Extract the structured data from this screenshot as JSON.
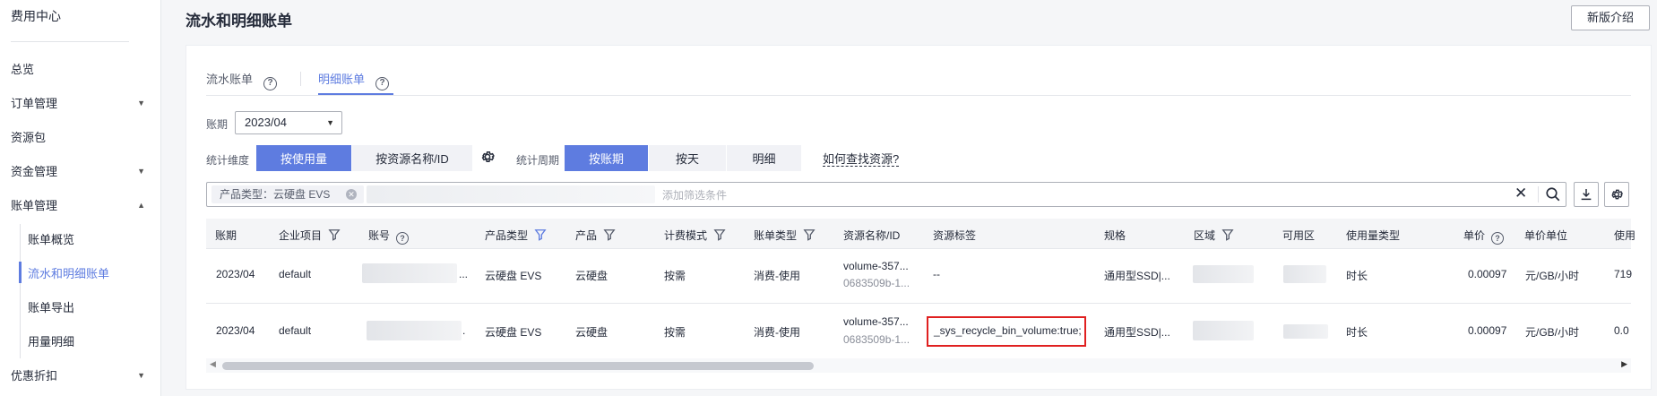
{
  "sidebar": {
    "brand": "费用中心",
    "items": [
      {
        "label": "总览"
      },
      {
        "label": "订单管理"
      },
      {
        "label": "资源包"
      },
      {
        "label": "资金管理"
      },
      {
        "label": "账单管理"
      },
      {
        "label": "优惠折扣"
      }
    ],
    "sub_items": [
      {
        "label": "账单概览"
      },
      {
        "label": "流水和明细账单"
      },
      {
        "label": "账单导出"
      },
      {
        "label": "用量明细"
      }
    ]
  },
  "header": {
    "title": "流水和明细账单",
    "intro_button": "新版介绍"
  },
  "tabs": [
    {
      "label": "流水账单"
    },
    {
      "label": "明细账单"
    }
  ],
  "filters": {
    "period_label": "账期",
    "period_value": "2023/04",
    "dimension_label": "统计维度",
    "dimension_options": [
      "按使用量",
      "按资源名称/ID"
    ],
    "cycle_label": "统计周期",
    "cycle_options": [
      "按账期",
      "按天",
      "明细"
    ],
    "howto_link": "如何查找资源?",
    "chip_label": "产品类型：云硬盘 EVS",
    "add_filter_placeholder": "添加筛选条件"
  },
  "table": {
    "columns": [
      "账期",
      "企业项目",
      "账号",
      "产品类型",
      "产品",
      "计费模式",
      "账单类型",
      "资源名称/ID",
      "资源标签",
      "规格",
      "区域",
      "可用区",
      "使用量类型",
      "单价",
      "单价单位",
      "使用"
    ],
    "rows": [
      {
        "period": "2023/04",
        "project": "default",
        "account_suffix": "...",
        "product_type": "云硬盘 EVS",
        "product": "云硬盘",
        "billing_mode": "按需",
        "bill_type": "消费-使用",
        "resource_name": "volume-357...",
        "resource_id": "0683509b-1...",
        "tag": "--",
        "spec": "通用型SSD|...",
        "usage_type": "时长",
        "unit_price": "0.00097",
        "price_unit": "元/GB/小时",
        "usage": "719"
      },
      {
        "period": "2023/04",
        "project": "default",
        "account_suffix": ".",
        "product_type": "云硬盘 EVS",
        "product": "云硬盘",
        "billing_mode": "按需",
        "bill_type": "消费-使用",
        "resource_name": "volume-357...",
        "resource_id": "0683509b-1...",
        "tag": "_sys_recycle_bin_volume:true;",
        "spec": "通用型SSD|...",
        "usage_type": "时长",
        "unit_price": "0.00097",
        "price_unit": "元/GB/小时",
        "usage": "0.0"
      }
    ]
  },
  "colors": {
    "accent": "#5e7ce0",
    "highlight_border": "#e02020"
  }
}
